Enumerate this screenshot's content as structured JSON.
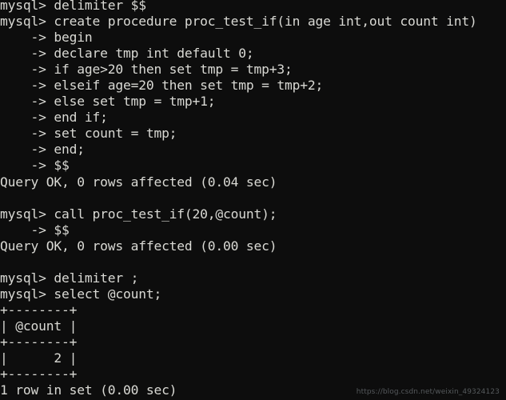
{
  "terminal": {
    "background_color": "#0d0d0d",
    "text_color": "#d9d9d4",
    "prompt": "mysql>",
    "continuation_prompt": "->",
    "lines": [
      "mysql> delimiter $$",
      "mysql> create procedure proc_test_if(in age int,out count int)",
      "    -> begin",
      "    -> declare tmp int default 0;",
      "    -> if age>20 then set tmp = tmp+3;",
      "    -> elseif age=20 then set tmp = tmp+2;",
      "    -> else set tmp = tmp+1;",
      "    -> end if;",
      "    -> set count = tmp;",
      "    -> end;",
      "    -> $$",
      "Query OK, 0 rows affected (0.04 sec)",
      "",
      "mysql> call proc_test_if(20,@count);",
      "    -> $$",
      "Query OK, 0 rows affected (0.00 sec)",
      "",
      "mysql> delimiter ;",
      "mysql> select @count;",
      "+--------+",
      "| @count |",
      "+--------+",
      "|      2 |",
      "+--------+",
      "1 row in set (0.00 sec)"
    ]
  },
  "result_table": {
    "headers": [
      "@count"
    ],
    "rows": [
      [
        "2"
      ]
    ],
    "status": "1 row in set (0.00 sec)"
  },
  "watermark": {
    "text": "https://blog.csdn.net/weixin_49324123",
    "color": "#55595c"
  }
}
